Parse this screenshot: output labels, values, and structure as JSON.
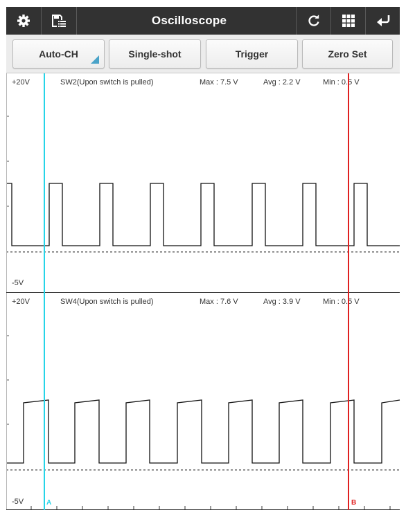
{
  "app": {
    "title": "Oscilloscope",
    "icons": [
      "gear-icon",
      "save-list-icon",
      "refresh-icon",
      "grid-icon",
      "back-arrow-icon"
    ]
  },
  "toolbar": {
    "buttons": [
      {
        "label": "Auto-CH",
        "has_menu": true
      },
      {
        "label": "Single-shot"
      },
      {
        "label": "Trigger"
      },
      {
        "label": "Zero Set"
      }
    ],
    "accent_color": "#4aa3c8"
  },
  "channels": [
    {
      "scale_top": "+20V",
      "scale_bottom": "-5V",
      "name": "SW2(Upon switch is pulled)",
      "max": "Max : 7.5 V",
      "avg": "Avg : 2.2 V",
      "min": "Min : 0.5 V"
    },
    {
      "scale_top": "+20V",
      "scale_bottom": "-5V",
      "name": "SW4(Upon switch is pulled)",
      "max": "Max : 7.6 V",
      "avg": "Avg : 3.9 V",
      "min": "Min : 0.5 V"
    }
  ],
  "cursors": {
    "a": {
      "label": "A",
      "color": "#26d4e8"
    },
    "b": {
      "label": "B",
      "color": "#e02020"
    }
  }
}
